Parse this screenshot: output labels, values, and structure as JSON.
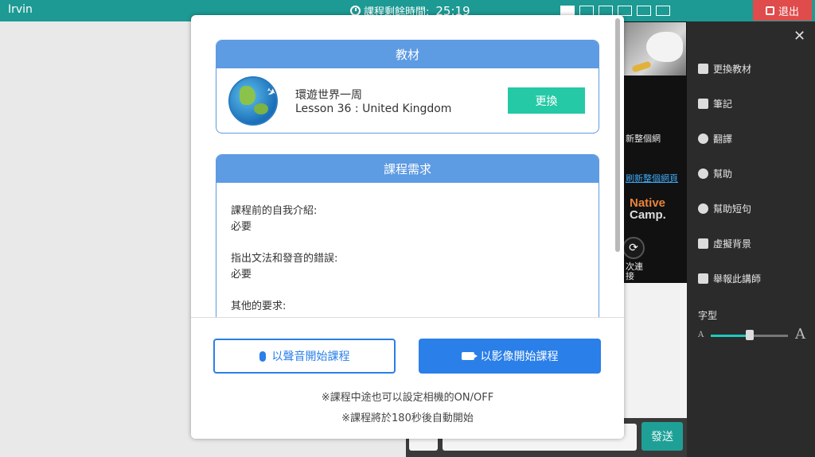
{
  "topbar": {
    "user": "Irvin",
    "timer_label": "課程剩餘時間:",
    "timer_value": "25:19",
    "exit_label": "退出"
  },
  "sidemenu": {
    "items": [
      {
        "label": "更換教材",
        "icon": "book-icon"
      },
      {
        "label": "筆記",
        "icon": "pencil-icon"
      },
      {
        "label": "翻譯",
        "icon": "globe-icon"
      },
      {
        "label": "幫助",
        "icon": "question-icon"
      },
      {
        "label": "幫助短句",
        "icon": "speech-bubble-icon"
      },
      {
        "label": "虛擬背景",
        "icon": "image-icon"
      },
      {
        "label": "舉報此講師",
        "icon": "flag-icon"
      }
    ],
    "font_size_label": "字型",
    "font_size_small": "A",
    "font_size_large": "A",
    "font_size_level": 0.5
  },
  "video_panel": {
    "text1": "新整個網",
    "link": "刷新整個網頁",
    "logo_line1": "Native",
    "logo_line2": "Camp.",
    "reconnect_line1": "次連",
    "reconnect_line2": "接"
  },
  "chat": {
    "send_label": "發送"
  },
  "modal": {
    "material": {
      "header": "教材",
      "title": "環遊世界一周",
      "lesson": "Lesson 36 : United Kingdom",
      "change_label": "更換"
    },
    "requirements": {
      "header": "課程需求",
      "items": [
        {
          "label": "課程前的自我介紹:",
          "value": "必要"
        },
        {
          "label": "指出文法和發音的錯誤:",
          "value": "必要"
        },
        {
          "label": "其他的要求:",
          "value": ""
        }
      ]
    },
    "voice_button": "以聲音開始課程",
    "video_button": "以影像開始課程",
    "note1": "※課程中途也可以設定相機的ON/OFF",
    "note2": "※課程將於180秒後自動開始"
  }
}
